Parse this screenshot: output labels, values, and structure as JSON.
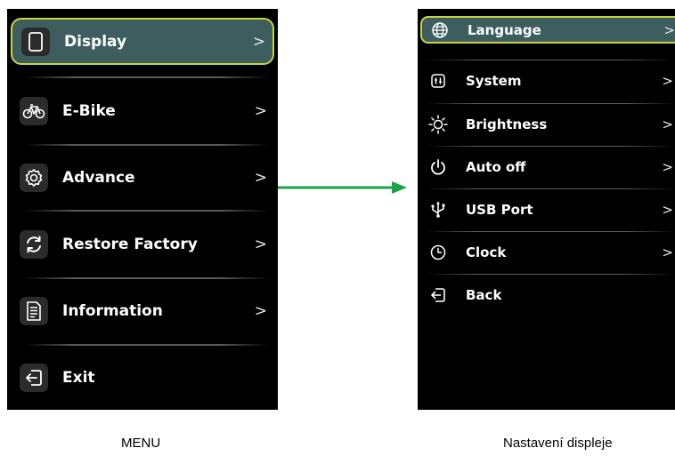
{
  "menu": {
    "caption": "MENU",
    "items": [
      {
        "label": "Display",
        "icon": "display-icon",
        "chevron": ">",
        "selected": true
      },
      {
        "label": "E-Bike",
        "icon": "bicycle-icon",
        "chevron": ">"
      },
      {
        "label": "Advance",
        "icon": "gear-icon",
        "chevron": ">"
      },
      {
        "label": "Restore Factory",
        "icon": "restore-icon",
        "chevron": ">"
      },
      {
        "label": "Information",
        "icon": "document-icon",
        "chevron": ">"
      },
      {
        "label": "Exit",
        "icon": "exit-icon"
      }
    ]
  },
  "display_settings": {
    "caption": "Nastavení displeje",
    "items": [
      {
        "label": "Language",
        "icon": "globe-icon",
        "chevron": ">",
        "selected": true
      },
      {
        "label": "System",
        "icon": "system-icon",
        "chevron": ">"
      },
      {
        "label": "Brightness",
        "icon": "sun-icon",
        "chevron": ">"
      },
      {
        "label": "Auto off",
        "icon": "power-icon",
        "chevron": ">"
      },
      {
        "label": "USB Port",
        "icon": "usb-icon",
        "chevron": ">"
      },
      {
        "label": "Clock",
        "icon": "clock-icon",
        "chevron": ">"
      },
      {
        "label": "Back",
        "icon": "back-icon"
      }
    ]
  },
  "colors": {
    "screen_background": "#000000",
    "selection_fill": "#3d5d5f",
    "selection_border": "#c7d63a",
    "arrow": "#1aa34a",
    "text": "#ffffff"
  }
}
